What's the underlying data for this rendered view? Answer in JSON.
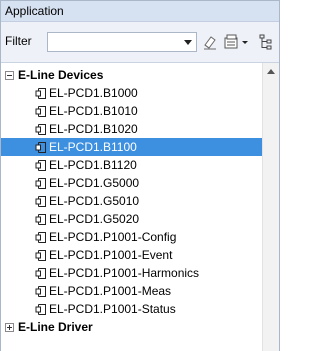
{
  "panel": {
    "title": "Application"
  },
  "filter": {
    "label": "Filter",
    "value": ""
  },
  "toolbar": {
    "clear_icon": "eraser-icon",
    "options_icon": "options-dropdown-icon",
    "view_icon": "tree-view-icon"
  },
  "tree": {
    "groups": [
      {
        "label": "E-Line Devices",
        "expanded": true,
        "items": [
          {
            "label": "EL-PCD1.B1000",
            "selected": false
          },
          {
            "label": "EL-PCD1.B1010",
            "selected": false
          },
          {
            "label": "EL-PCD1.B1020",
            "selected": false
          },
          {
            "label": "EL-PCD1.B1100",
            "selected": true
          },
          {
            "label": "EL-PCD1.B1120",
            "selected": false
          },
          {
            "label": "EL-PCD1.G5000",
            "selected": false
          },
          {
            "label": "EL-PCD1.G5010",
            "selected": false
          },
          {
            "label": "EL-PCD1.G5020",
            "selected": false
          },
          {
            "label": "EL-PCD1.P1001-Config",
            "selected": false
          },
          {
            "label": "EL-PCD1.P1001-Event",
            "selected": false
          },
          {
            "label": "EL-PCD1.P1001-Harmonics",
            "selected": false
          },
          {
            "label": "EL-PCD1.P1001-Meas",
            "selected": false
          },
          {
            "label": "EL-PCD1.P1001-Status",
            "selected": false
          }
        ]
      },
      {
        "label": "E-Line Driver",
        "expanded": false,
        "items": []
      }
    ]
  },
  "colors": {
    "selection": "#3d8fe0",
    "header": "#d6e1f1",
    "filterbar": "#eef2f8"
  }
}
